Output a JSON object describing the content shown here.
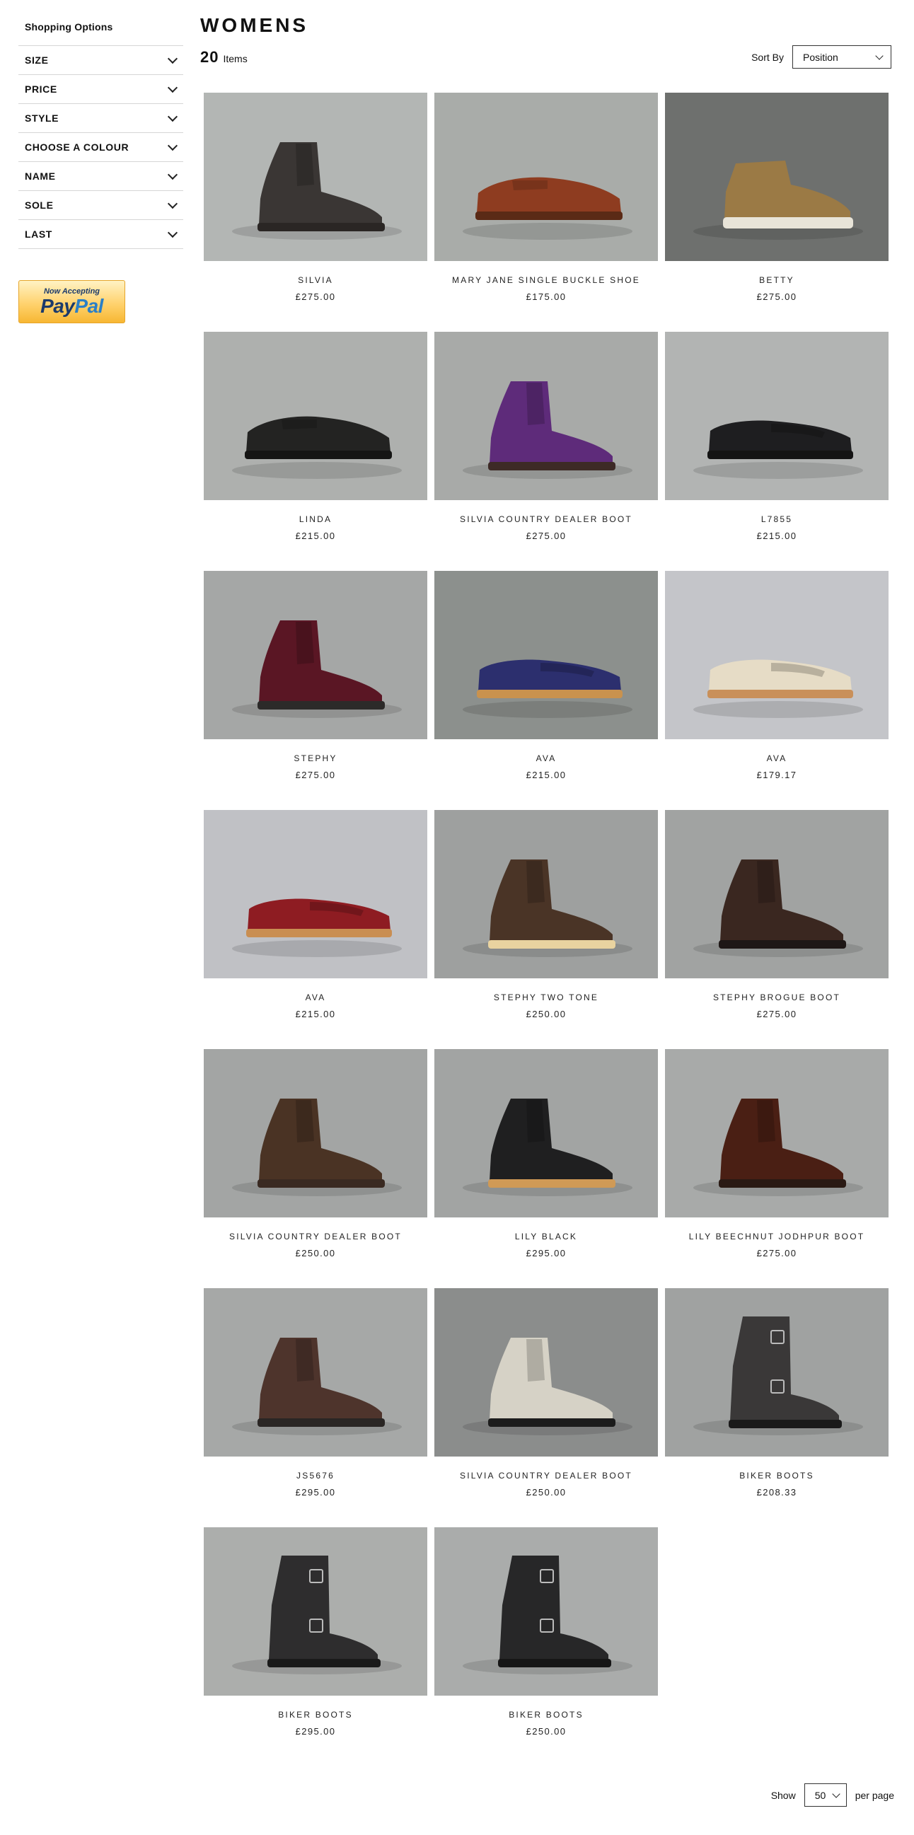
{
  "sidebar": {
    "title": "Shopping Options",
    "filters": [
      {
        "label": "SIZE"
      },
      {
        "label": "PRICE"
      },
      {
        "label": "STYLE"
      },
      {
        "label": "CHOOSE A COLOUR"
      },
      {
        "label": "NAME"
      },
      {
        "label": "SOLE"
      },
      {
        "label": "LAST"
      }
    ],
    "paypal": {
      "small": "Now Accepting",
      "brand_a": "Pay",
      "brand_b": "Pal"
    }
  },
  "header": {
    "title": "WOMENS",
    "count": "20",
    "count_label": "Items",
    "sort_label": "Sort By",
    "sort_value": "Position"
  },
  "products": [
    {
      "name": "SILVIA",
      "price": "£275.00",
      "bg": "#b3b6b4",
      "shoe": "#3a3634",
      "sole": "#2a2624",
      "type": "boot"
    },
    {
      "name": "MARY JANE SINGLE BUCKLE SHOE",
      "price": "£175.00",
      "bg": "#a9aca9",
      "shoe": "#8e3c20",
      "sole": "#5a2a16",
      "type": "shoe"
    },
    {
      "name": "BETTY",
      "price": "£275.00",
      "bg": "#6e706e",
      "shoe": "#9b7a45",
      "sole": "#e8e4d8",
      "type": "chukka"
    },
    {
      "name": "LINDA",
      "price": "£215.00",
      "bg": "#aeb0ae",
      "shoe": "#232322",
      "sole": "#151514",
      "type": "shoe"
    },
    {
      "name": "SILVIA COUNTRY DEALER BOOT",
      "price": "£275.00",
      "bg": "#a8aaa8",
      "shoe": "#5e2b7a",
      "sole": "#3d2a26",
      "type": "boot"
    },
    {
      "name": "L7855",
      "price": "£215.00",
      "bg": "#b2b4b3",
      "shoe": "#1e1e20",
      "sole": "#141414",
      "type": "loafer"
    },
    {
      "name": "STEPHY",
      "price": "£275.00",
      "bg": "#a5a7a6",
      "shoe": "#5a1624",
      "sole": "#2c2a29",
      "type": "boot"
    },
    {
      "name": "AVA",
      "price": "£215.00",
      "bg": "#8c908d",
      "shoe": "#2c2f6e",
      "sole": "#c9924e",
      "type": "loafer"
    },
    {
      "name": "AVA",
      "price": "£179.17",
      "bg": "#c4c5c9",
      "shoe": "#e6dcc6",
      "sole": "#c9905a",
      "type": "loafer"
    },
    {
      "name": "AVA",
      "price": "£215.00",
      "bg": "#c0c1c5",
      "shoe": "#8e1c22",
      "sole": "#c98e52",
      "type": "loafer"
    },
    {
      "name": "STEPHY TWO TONE",
      "price": "£250.00",
      "bg": "#9ea09f",
      "shoe": "#4a3426",
      "sole": "#e9d3a0",
      "type": "boot"
    },
    {
      "name": "STEPHY BROGUE BOOT",
      "price": "£275.00",
      "bg": "#a1a3a2",
      "shoe": "#3a2720",
      "sole": "#1e1716",
      "type": "boot"
    },
    {
      "name": "SILVIA COUNTRY DEALER BOOT",
      "price": "£250.00",
      "bg": "#a3a5a4",
      "shoe": "#4a3324",
      "sole": "#3a2a22",
      "type": "boot"
    },
    {
      "name": "LILY BLACK",
      "price": "£295.00",
      "bg": "#a2a4a3",
      "shoe": "#1f1f20",
      "sole": "#d09a56",
      "type": "boot"
    },
    {
      "name": "LILY BEECHNUT JODHPUR BOOT",
      "price": "£275.00",
      "bg": "#a8aaa9",
      "shoe": "#4a1f14",
      "sole": "#2a1a14",
      "type": "boot"
    },
    {
      "name": "JS5676",
      "price": "£295.00",
      "bg": "#a6a8a7",
      "shoe": "#4e342c",
      "sole": "#2a2624",
      "type": "boot"
    },
    {
      "name": "SILVIA COUNTRY DEALER BOOT",
      "price": "£250.00",
      "bg": "#8b8d8c",
      "shoe": "#d6d2c6",
      "sole": "#1c1c1c",
      "type": "boot"
    },
    {
      "name": "BIKER BOOTS",
      "price": "£208.33",
      "bg": "#a0a2a1",
      "shoe": "#3a3838",
      "sole": "#1a1a1a",
      "type": "tallboot"
    },
    {
      "name": "BIKER BOOTS",
      "price": "£295.00",
      "bg": "#acaeac",
      "shoe": "#2e2d2e",
      "sole": "#1a1a1a",
      "type": "tallboot"
    },
    {
      "name": "BIKER BOOTS",
      "price": "£250.00",
      "bg": "#aaacab",
      "shoe": "#272728",
      "sole": "#161616",
      "type": "tallboot"
    }
  ],
  "toolbar_bottom": {
    "show_label": "Show",
    "limit_value": "50",
    "per_page_label": "per page"
  }
}
